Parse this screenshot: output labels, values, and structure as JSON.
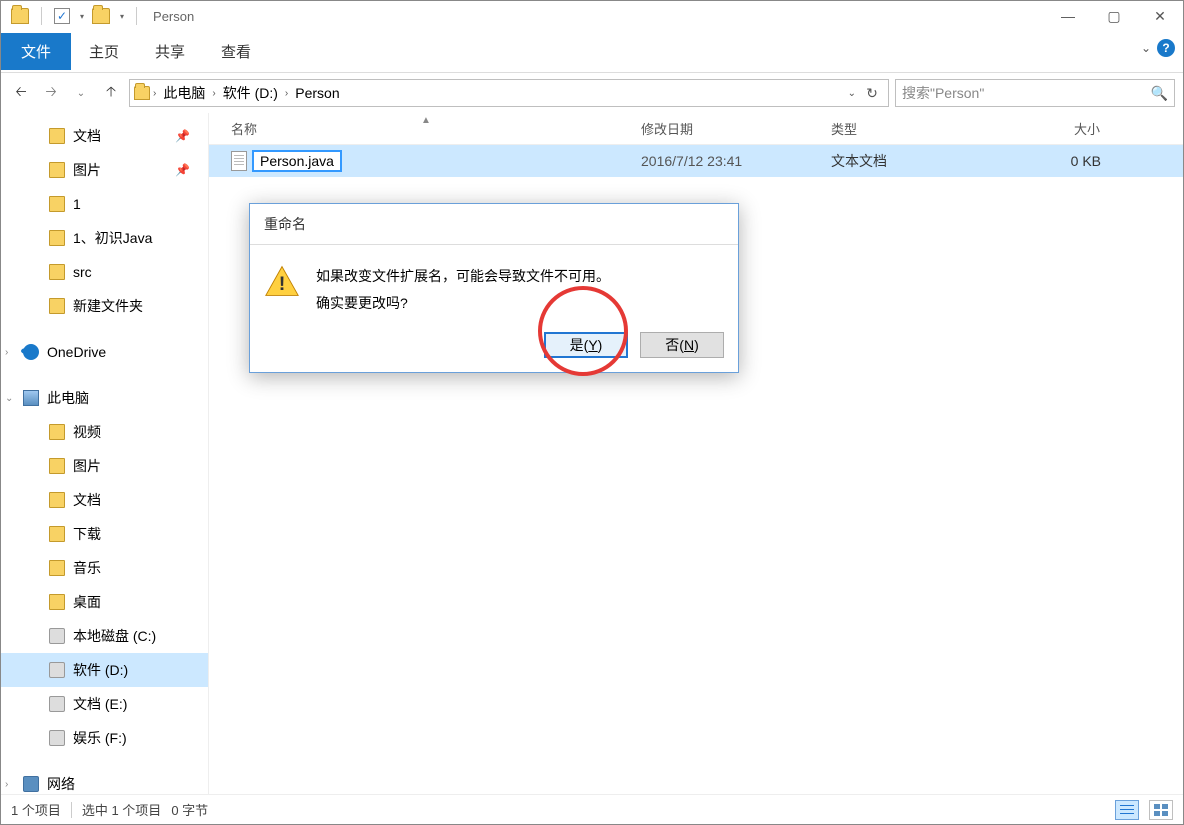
{
  "title": "Person",
  "ribbon": {
    "file": "文件",
    "home": "主页",
    "share": "共享",
    "view": "查看"
  },
  "breadcrumbs": [
    "此电脑",
    "软件 (D:)",
    "Person"
  ],
  "search_placeholder": "搜索\"Person\"",
  "columns": {
    "name": "名称",
    "date": "修改日期",
    "type": "类型",
    "size": "大小"
  },
  "file": {
    "name": "Person.java",
    "date": "2016/7/12 23:41",
    "type": "文本文档",
    "size": "0 KB"
  },
  "sidebar": {
    "quick": [
      {
        "label": "文档",
        "pin": true
      },
      {
        "label": "图片",
        "pin": true
      },
      {
        "label": "1"
      },
      {
        "label": "1、初识Java"
      },
      {
        "label": "src"
      },
      {
        "label": "新建文件夹"
      }
    ],
    "onedrive": "OneDrive",
    "thispc": "此电脑",
    "thispc_items": [
      "视频",
      "图片",
      "文档",
      "下载",
      "音乐",
      "桌面"
    ],
    "drives": [
      "本地磁盘 (C:)",
      "软件 (D:)",
      "文档 (E:)",
      "娱乐 (F:)"
    ],
    "network": "网络"
  },
  "dialog": {
    "title": "重命名",
    "line1": "如果改变文件扩展名，可能会导致文件不可用。",
    "line2": "确实要更改吗?",
    "yes": "是(",
    "yes_key": "Y",
    "yes_end": ")",
    "no": "否(",
    "no_key": "N",
    "no_end": ")"
  },
  "status": {
    "items": "1 个项目",
    "selected": "选中 1 个项目",
    "size": "0 字节"
  }
}
